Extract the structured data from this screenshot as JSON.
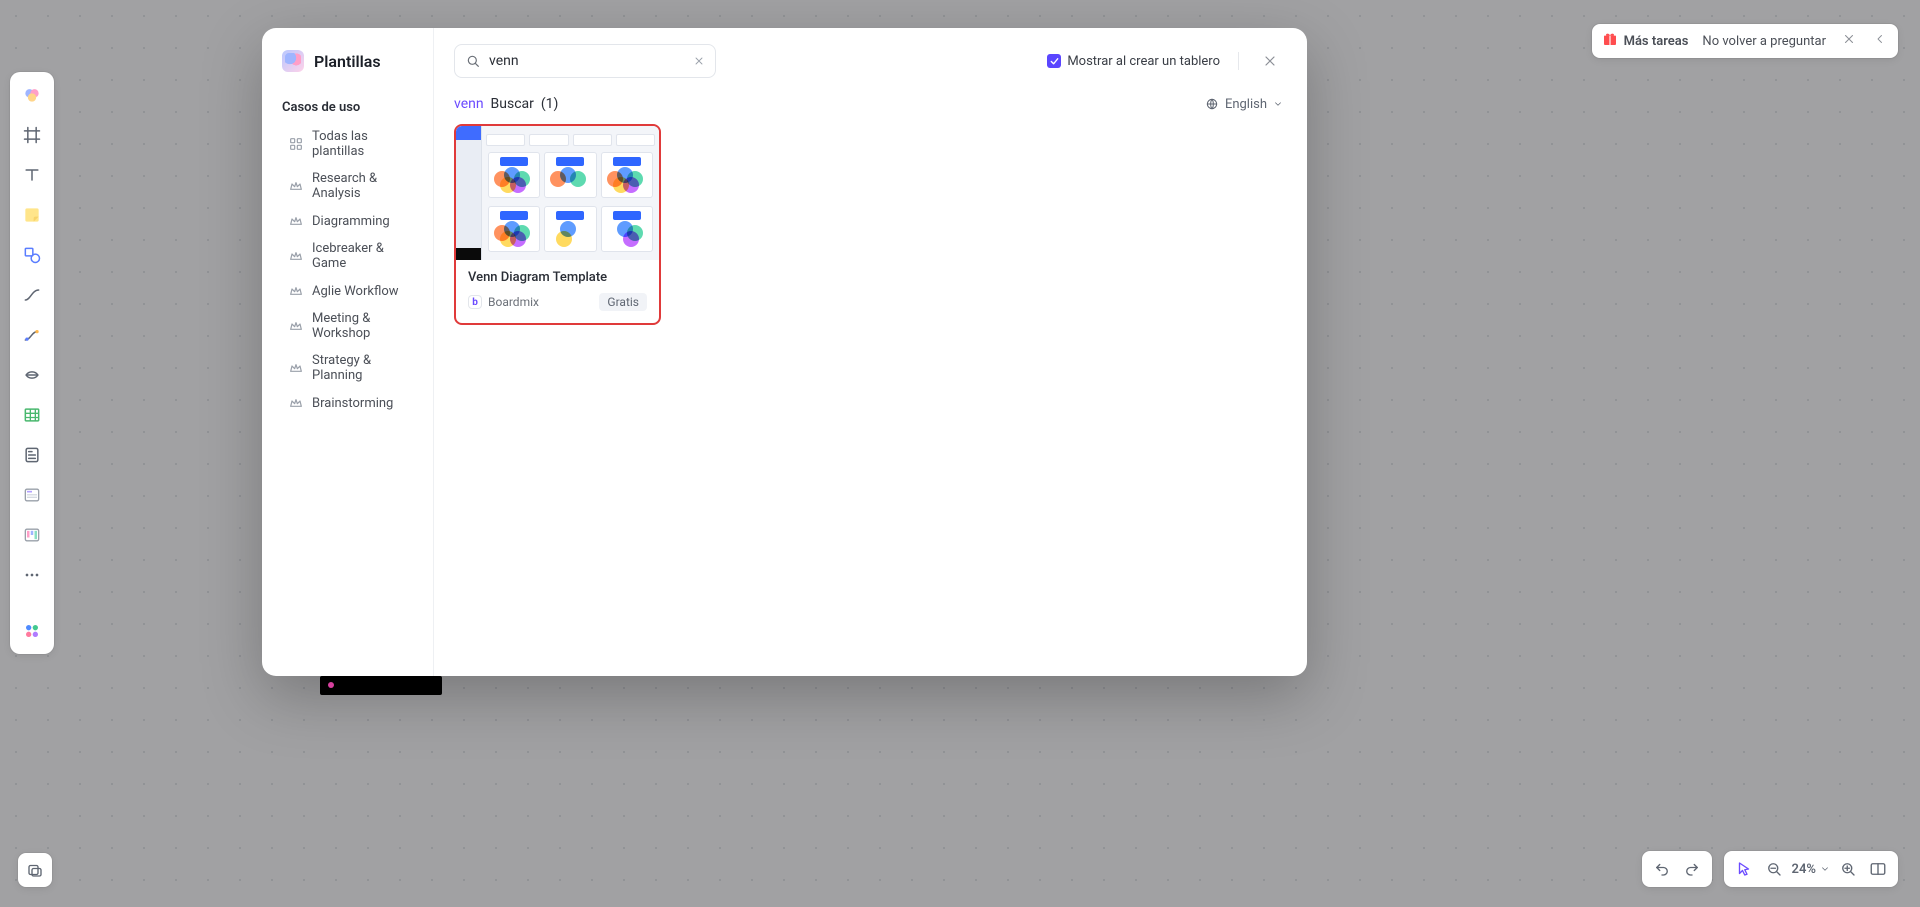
{
  "top_notice": {
    "more_tasks": "Más tareas",
    "dont_ask": "No volver a preguntar"
  },
  "bottom_controls": {
    "zoom_label": "24%"
  },
  "modal": {
    "title": "Plantillas",
    "section_label": "Casos de uso",
    "categories": [
      "Todas las plantillas",
      "Research & Analysis",
      "Diagramming",
      "Icebreaker & Game",
      "Aglie Workflow",
      "Meeting & Workshop",
      "Strategy & Planning",
      "Brainstorming"
    ],
    "search_value": "venn",
    "show_on_create_label": "Mostrar al crear un tablero",
    "results": {
      "keyword": "venn",
      "label": "Buscar",
      "count_text": "(1)"
    },
    "language": "English",
    "template": {
      "title": "Venn Diagram Template",
      "author": "Boardmix",
      "badge": "Gratis"
    }
  }
}
